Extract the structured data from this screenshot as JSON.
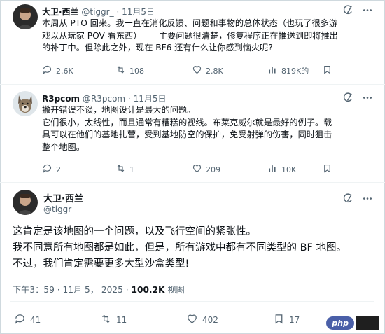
{
  "tweet1": {
    "display_name": "大卫·西兰",
    "handle": "@tiggr_",
    "dot": "·",
    "date": "11月5日",
    "lines": [
      "本周从 PTO 回来。我一直在消化反馈、问题和事物的总体状态（也玩了很多游",
      "戏以从玩家 POV 看东西）——主要问题很清楚，修复程序正在推送到即将推出",
      "的补丁中。但除此之外，现在 BF6 还有什么让你感到恼火呢?"
    ],
    "replies": "2.6K",
    "reposts": "108",
    "likes": "2.8K",
    "views": "819K的"
  },
  "tweet2": {
    "display_name": "R3pcom",
    "handle": "@R3pcom",
    "dot": "·",
    "date": "11月5日",
    "lines": [
      "撇开错误不谈，地图设计是最大的问题。",
      "它们很小，太线性，而且通常有糟糕的视线。布莱克威尔就是最好的例子。载",
      "具可以在他们的基地扎营，受到基地防空的保护，免受射弹的伤害，同时狙击",
      "整个地图。"
    ],
    "replies": "2",
    "reposts": "1",
    "likes": "209",
    "views": "10K"
  },
  "main": {
    "display_name": "大卫·西兰",
    "handle": "@tiggr_",
    "lines": [
      "这肯定是该地图的一个问题，以及飞行空间的紧张性。",
      "我不同意所有地图都是如此，但是，所有游戏中都有不同类型的 BF 地图。",
      "不过，我们肯定需要更多大型沙盒类型!"
    ],
    "time": "下午3：59",
    "date": "11月 5， 2025",
    "dot": "·",
    "views_count": "100.2K",
    "views_label": "视图",
    "replies": "41",
    "reposts": "11",
    "likes": "402",
    "bookmarks": "17"
  },
  "watermark": {
    "text": "php"
  },
  "icons": {
    "reply": "reply-icon",
    "repost": "repost-icon",
    "like": "heart-icon",
    "views": "views-chart-icon",
    "grok": "grok-icon",
    "more": "more-icon",
    "bookmark": "bookmark-icon",
    "share": "share-icon"
  },
  "colors": {
    "text": "#0f1419",
    "muted": "#536471",
    "border": "#cfd9de",
    "watermark": "#4a5fa8"
  }
}
